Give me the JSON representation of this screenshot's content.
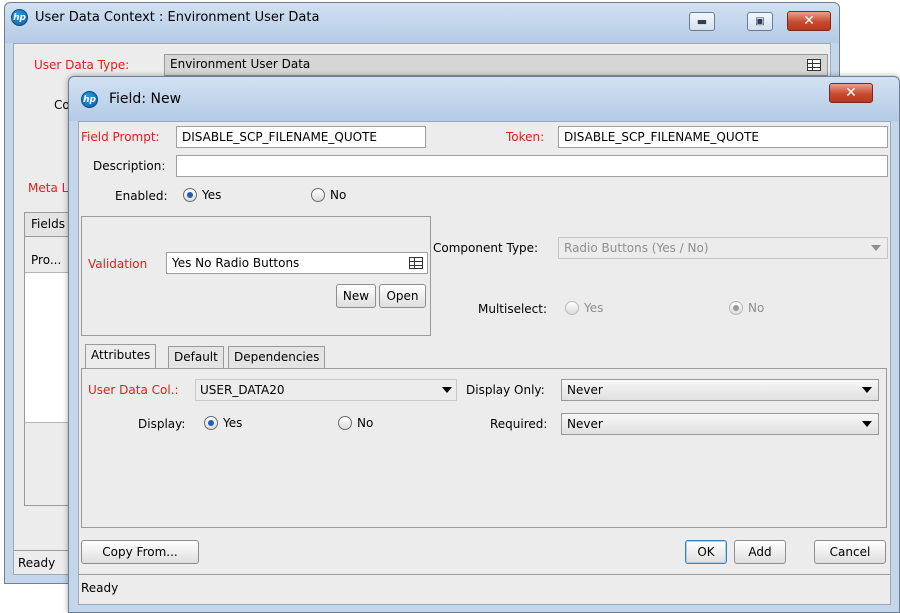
{
  "back_window": {
    "title": "User Data Context : Environment User Data",
    "user_data_type_label": "User Data Type:",
    "user_data_type_value": "Environment User Data",
    "co_label": "Co",
    "meta_label": "Meta L",
    "fields_tab": "Fields",
    "column_pro": "Pro...",
    "status": "Ready"
  },
  "front_window": {
    "title": "Field: New",
    "field_prompt_label": "Field Prompt:",
    "field_prompt_value": "DISABLE_SCP_FILENAME_QUOTE",
    "token_label": "Token:",
    "token_value": "DISABLE_SCP_FILENAME_QUOTE",
    "description_label": "Description:",
    "description_value": "",
    "enabled_label": "Enabled:",
    "enabled_yes": "Yes",
    "enabled_no": "No",
    "enabled_selected": "Yes",
    "validation_label": "Validation",
    "validation_value": "Yes No Radio Buttons",
    "new_button": "New",
    "open_button": "Open",
    "component_type_label": "Component Type:",
    "component_type_value": "Radio Buttons (Yes / No)",
    "multiselect_label": "Multiselect:",
    "multiselect_yes": "Yes",
    "multiselect_no": "No",
    "tabs": [
      "Attributes",
      "Default",
      "Dependencies"
    ],
    "active_tab": "Attributes",
    "user_data_col_label": "User Data Col.:",
    "user_data_col_value": "USER_DATA20",
    "display_only_label": "Display Only:",
    "display_only_value": "Never",
    "display_label": "Display:",
    "display_yes": "Yes",
    "display_no": "No",
    "required_label": "Required:",
    "required_value": "Never",
    "copy_from_button": "Copy From...",
    "ok_button": "OK",
    "add_button": "Add",
    "cancel_button": "Cancel",
    "status": "Ready"
  },
  "colors": {
    "required_label": "#e0201b",
    "titlebar": "#c3d6ea",
    "close_button": "#c74a2e"
  }
}
